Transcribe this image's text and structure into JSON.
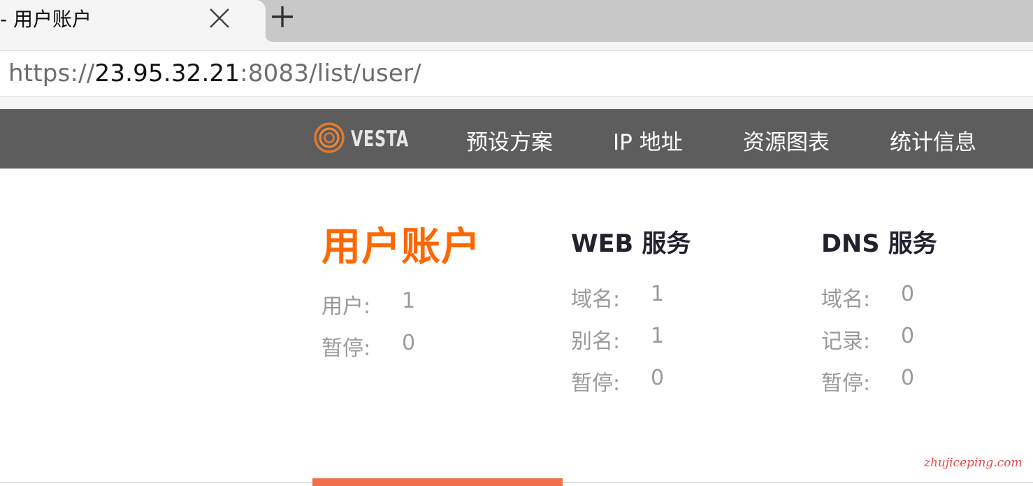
{
  "browser": {
    "tab_title": "- 用户账户",
    "new_tab_symbol": "+",
    "url": {
      "scheme": "https://",
      "host": "23.95.32.21",
      "rest": ":8083/list/user/"
    }
  },
  "nav": {
    "logo": "VESTA",
    "items": [
      "预设方案",
      "IP 地址",
      "资源图表",
      "统计信息"
    ]
  },
  "stats": {
    "users": {
      "title": "用户账户",
      "rows": [
        {
          "label": "用户:",
          "value": "1"
        },
        {
          "label": "暂停:",
          "value": "0"
        }
      ]
    },
    "web": {
      "title": "WEB 服务",
      "rows": [
        {
          "label": "域名:",
          "value": "1"
        },
        {
          "label": "别名:",
          "value": "1"
        },
        {
          "label": "暂停:",
          "value": "0"
        }
      ]
    },
    "dns": {
      "title": "DNS 服务",
      "rows": [
        {
          "label": "域名:",
          "value": "0"
        },
        {
          "label": "记录:",
          "value": "0"
        },
        {
          "label": "暂停:",
          "value": "0"
        }
      ]
    }
  },
  "watermark": "zhujiceping.com",
  "colors": {
    "accent": "#ff6701",
    "nav_bg": "#5d5d5d",
    "indicator": "#f0704a",
    "stat_text": "#9a9a9a",
    "heading": "#22222e"
  },
  "icons": {
    "tab_close": "close-icon",
    "new_tab": "plus-icon",
    "logo": "vesta-logo-icon"
  }
}
